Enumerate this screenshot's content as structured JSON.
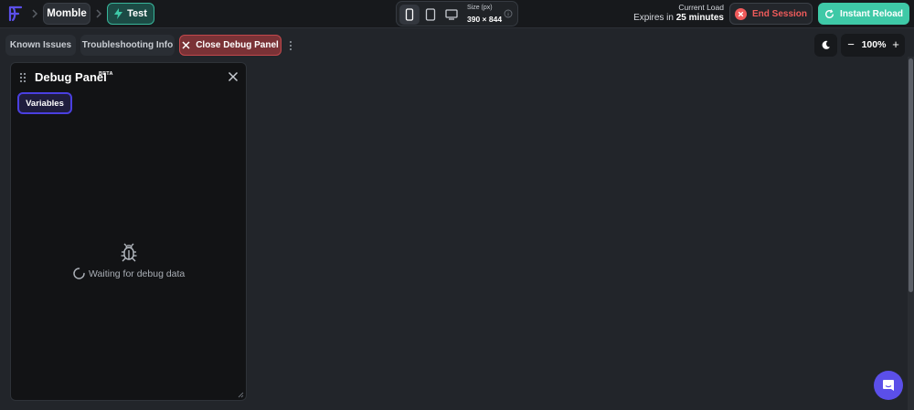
{
  "topbar": {
    "project_name": "Momble",
    "test_label": "Test",
    "device": {
      "size_label": "Size (px)",
      "size_value": "390 × 844",
      "options": [
        "mobile",
        "tablet",
        "desktop"
      ],
      "selected": "mobile"
    },
    "load_label": "Current Load",
    "expires_prefix": "Expires in",
    "expires_value": "25 minutes",
    "end_session_label": "End Session",
    "reload_label": "Instant Reload"
  },
  "toolbar": {
    "known_issues_label": "Known Issues",
    "troubleshooting_label": "Troubleshooting Info",
    "close_debug_label": "Close Debug Panel",
    "zoom_value": "100%",
    "zoom_minus": "−",
    "zoom_plus": "+"
  },
  "debug_panel": {
    "title": "Debug Panel",
    "badge": "BETA",
    "tabs": [
      {
        "label": "Variables",
        "active": true
      }
    ],
    "empty_state": "Waiting for debug data"
  },
  "colors": {
    "accent": "#3ec9a7",
    "danger": "#ef5b5b",
    "primary": "#5b4fe9",
    "background": "#22252a"
  }
}
